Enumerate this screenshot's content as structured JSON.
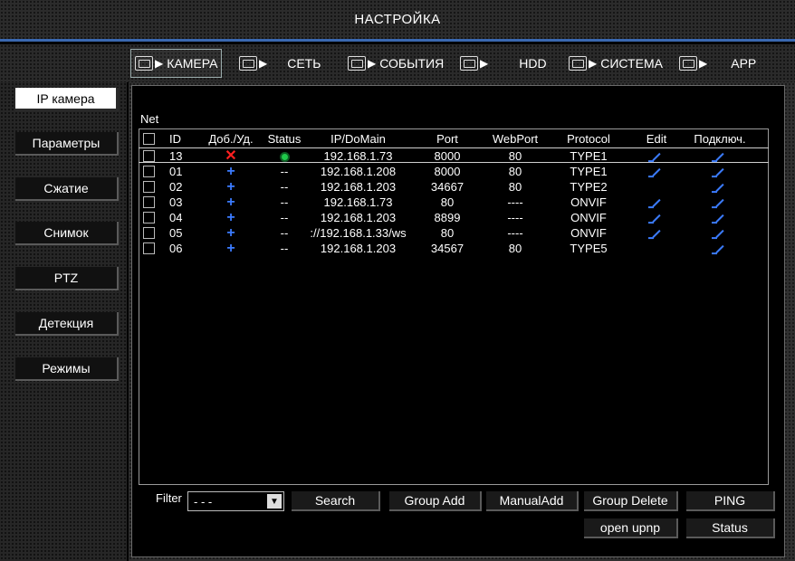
{
  "title": "НАСТРОЙКА",
  "tabs": [
    {
      "label": "КАМЕРА",
      "icon": "camera-icon",
      "active": true
    },
    {
      "label": "СЕТЬ",
      "icon": "network-icon",
      "active": false
    },
    {
      "label": "СОБЫТИЯ",
      "icon": "alarm-icon",
      "active": false
    },
    {
      "label": "HDD",
      "icon": "hdd-icon",
      "active": false
    },
    {
      "label": "СИСТЕМА",
      "icon": "system-icon",
      "active": false
    },
    {
      "label": "APP",
      "icon": "app-icon",
      "active": false
    }
  ],
  "sidebar": {
    "items": [
      {
        "label": "IP камера",
        "active": true
      },
      {
        "label": "Параметры",
        "active": false
      },
      {
        "label": "Сжатие",
        "active": false
      },
      {
        "label": "Снимок",
        "active": false
      },
      {
        "label": "PTZ",
        "active": false
      },
      {
        "label": "Детекция",
        "active": false
      },
      {
        "label": "Режимы",
        "active": false
      }
    ]
  },
  "main": {
    "net_label": "Net",
    "columns": {
      "id": "ID",
      "add_del": "Доб./Уд.",
      "status": "Status",
      "ip": "IP/DoMain",
      "port": "Port",
      "webport": "WebPort",
      "protocol": "Protocol",
      "edit": "Edit",
      "connect": "Подключ."
    },
    "rows": [
      {
        "id": "13",
        "action": "delete",
        "status": "online",
        "ip": "192.168.1.73",
        "port": "8000",
        "webport": "80",
        "protocol": "TYPE1",
        "edit": true,
        "connect": true,
        "selected": true
      },
      {
        "id": "01",
        "action": "add",
        "status": "--",
        "ip": "192.168.1.208",
        "port": "8000",
        "webport": "80",
        "protocol": "TYPE1",
        "edit": true,
        "connect": true,
        "selected": false
      },
      {
        "id": "02",
        "action": "add",
        "status": "--",
        "ip": "192.168.1.203",
        "port": "34667",
        "webport": "80",
        "protocol": "TYPE2",
        "edit": false,
        "connect": true,
        "selected": false
      },
      {
        "id": "03",
        "action": "add",
        "status": "--",
        "ip": "192.168.1.73",
        "port": "80",
        "webport": "----",
        "protocol": "ONVIF",
        "edit": true,
        "connect": true,
        "selected": false
      },
      {
        "id": "04",
        "action": "add",
        "status": "--",
        "ip": "192.168.1.203",
        "port": "8899",
        "webport": "----",
        "protocol": "ONVIF",
        "edit": true,
        "connect": true,
        "selected": false
      },
      {
        "id": "05",
        "action": "add",
        "status": "--",
        "ip": "://192.168.1.33/ws",
        "port": "80",
        "webport": "----",
        "protocol": "ONVIF",
        "edit": true,
        "connect": true,
        "selected": false
      },
      {
        "id": "06",
        "action": "add",
        "status": "--",
        "ip": "192.168.1.203",
        "port": "34567",
        "webport": "80",
        "protocol": "TYPE5",
        "edit": false,
        "connect": true,
        "selected": false
      }
    ]
  },
  "toolbar": {
    "filter_label": "Filter",
    "filter_value": "- - -",
    "search": "Search",
    "group_add": "Group Add",
    "manual_add": "ManualAdd",
    "group_delete": "Group Delete",
    "ping": "PING",
    "open_upnp": "open upnp",
    "status": "Status"
  },
  "colors": {
    "accent_line": "#3a68b0",
    "add_icon": "#3b7bff",
    "delete_icon": "#ff2020",
    "online_status": "#1fc84a"
  }
}
